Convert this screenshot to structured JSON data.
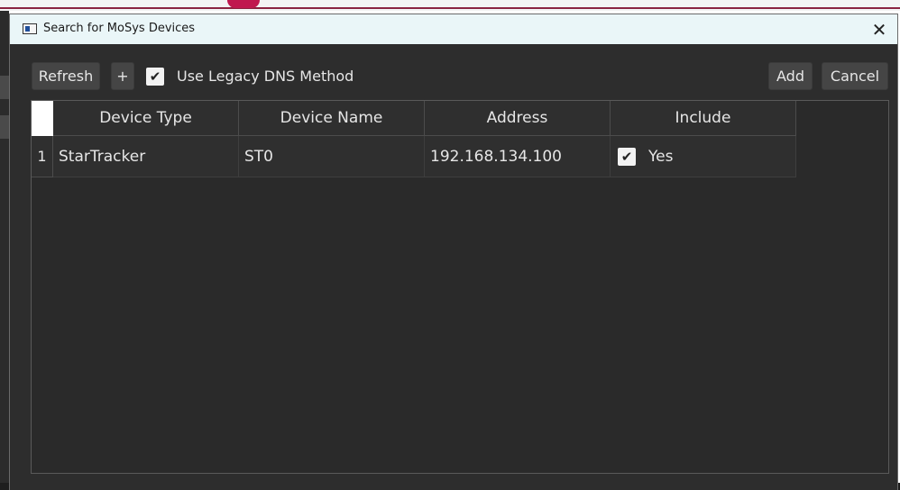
{
  "window": {
    "title": "Search for MoSys Devices",
    "close_glyph": "✕",
    "app_icon": "window-icon"
  },
  "toolbar": {
    "refresh_label": "Refresh",
    "plus_label": "+",
    "legacy_dns": {
      "label": "Use Legacy DNS Method",
      "checked": true,
      "check_glyph": "✔"
    },
    "add_label": "Add",
    "cancel_label": "Cancel"
  },
  "table": {
    "columns": [
      "Device Type",
      "Device Name",
      "Address",
      "Include"
    ],
    "rows": [
      {
        "index": "1",
        "device_type": "StarTracker",
        "device_name": "ST0",
        "address": "192.168.134.100",
        "include": {
          "checked": true,
          "check_glyph": "✔",
          "label": "Yes"
        }
      }
    ]
  },
  "colors": {
    "dialog_bg": "#2d2d2d",
    "titlebar_bg": "#eaf6f8",
    "button_bg": "#454545",
    "text": "#e6e6e6",
    "brand_accent": "#c0184f"
  }
}
